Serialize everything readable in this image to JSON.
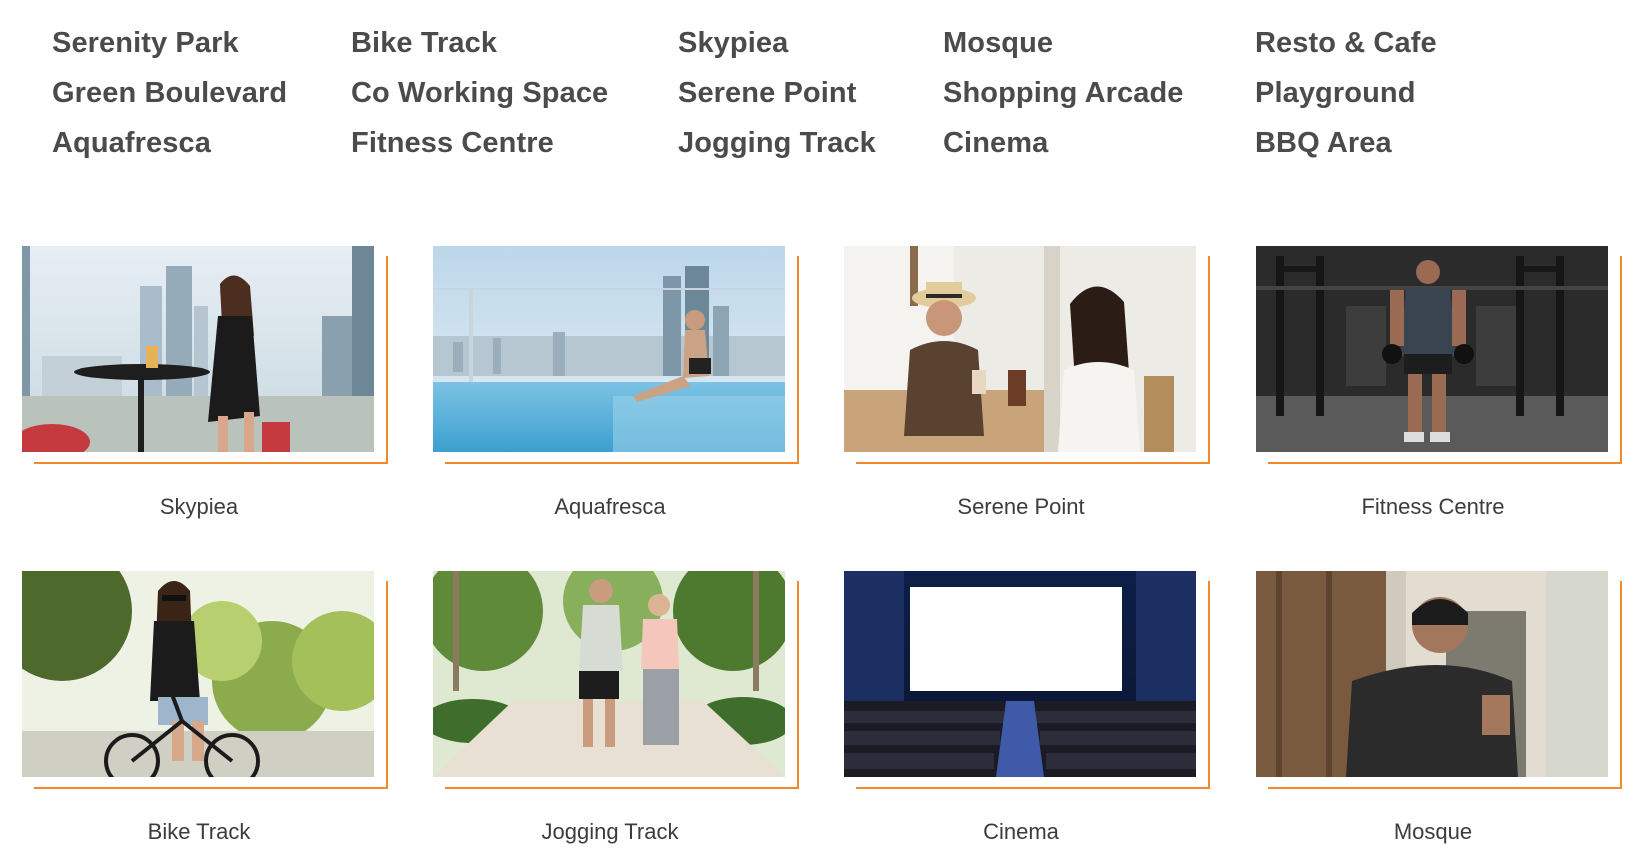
{
  "facilities": {
    "columns": [
      [
        "Serenity Park",
        "Green Boulevard",
        "Aquafresca"
      ],
      [
        "Bike Track",
        "Co Working Space",
        "Fitness Centre"
      ],
      [
        "Skypiea",
        "Serene Point",
        "Jogging Track"
      ],
      [
        "Mosque",
        "Shopping Arcade",
        "Cinema"
      ],
      [
        "Resto & Cafe",
        "Playground",
        "BBQ Area"
      ]
    ]
  },
  "gallery": {
    "accent_color": "#f08a2c",
    "cards": [
      {
        "caption": "Skypiea",
        "image": "rooftop-city-woman-photo"
      },
      {
        "caption": "Aquafresca",
        "image": "infinity-pool-photo"
      },
      {
        "caption": "Serene Point",
        "image": "couple-cafe-photo"
      },
      {
        "caption": "Fitness Centre",
        "image": "gym-man-photo"
      },
      {
        "caption": "Bike Track",
        "image": "woman-bicycle-park-photo"
      },
      {
        "caption": "Jogging Track",
        "image": "couple-jogging-photo"
      },
      {
        "caption": "Cinema",
        "image": "cinema-hall-photo"
      },
      {
        "caption": "Mosque",
        "image": "man-praying-photo"
      }
    ]
  }
}
